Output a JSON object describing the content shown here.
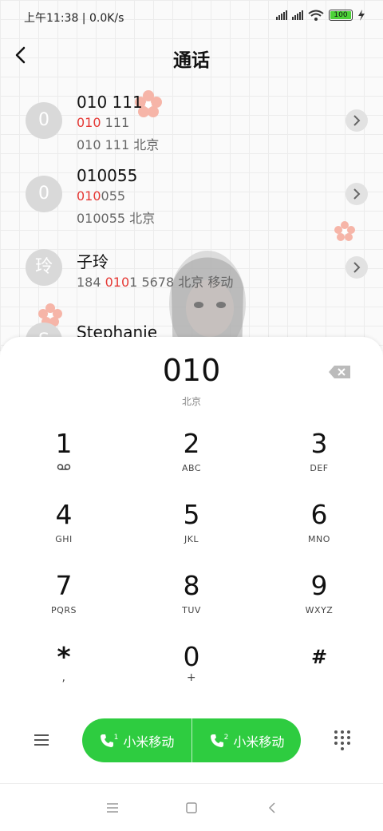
{
  "status_bar": {
    "time_speed": "上午11:38 | 0.0K/s",
    "battery": "100"
  },
  "header": {
    "title": "通话"
  },
  "contacts": [
    {
      "avatar": "0",
      "name": "010 111",
      "hl": "010",
      "rest": " 111",
      "extra": "010 111 北京"
    },
    {
      "avatar": "0",
      "name": "010055",
      "hl": "010",
      "rest": "055",
      "extra": "010055 北京"
    },
    {
      "avatar": "玲",
      "name": "子玲",
      "pre": "184 ",
      "hl": "010",
      "rest": "1 5678 北京 移动"
    },
    {
      "avatar": "S",
      "name": "Stephanie"
    }
  ],
  "dialer": {
    "number": "010",
    "location": "北京",
    "keys": [
      {
        "digit": "1",
        "sub": ""
      },
      {
        "digit": "2",
        "sub": "ABC"
      },
      {
        "digit": "3",
        "sub": "DEF"
      },
      {
        "digit": "4",
        "sub": "GHI"
      },
      {
        "digit": "5",
        "sub": "JKL"
      },
      {
        "digit": "6",
        "sub": "MNO"
      },
      {
        "digit": "7",
        "sub": "PQRS"
      },
      {
        "digit": "8",
        "sub": "TUV"
      },
      {
        "digit": "9",
        "sub": "WXYZ"
      },
      {
        "digit": "*",
        "sub": ","
      },
      {
        "digit": "0",
        "sub": "+"
      },
      {
        "digit": "#",
        "sub": ""
      }
    ],
    "call1": {
      "sim": "1",
      "label": "小米移动"
    },
    "call2": {
      "sim": "2",
      "label": "小米移动"
    }
  },
  "colors": {
    "accent_green": "#2ecc40",
    "highlight_red": "#e53935"
  }
}
